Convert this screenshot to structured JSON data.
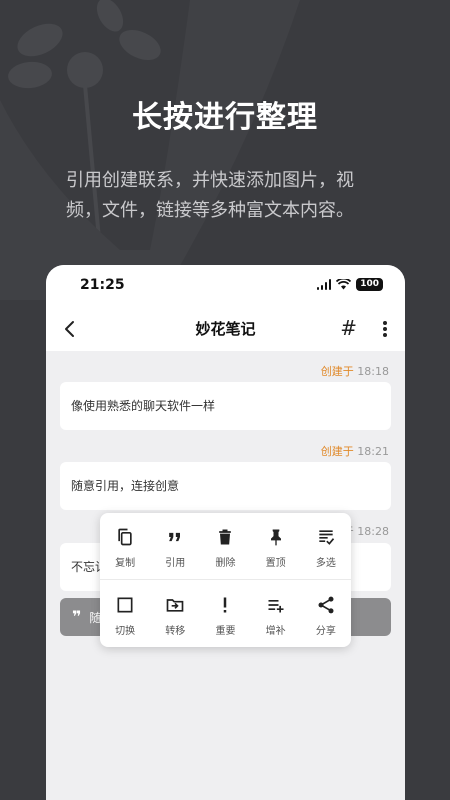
{
  "headline": "长按进行整理",
  "subtitle": "引用创建联系，并快速添加图片，视频，文件，链接等多种富文本内容。",
  "status_bar": {
    "time": "21:25",
    "battery": "100"
  },
  "app_bar": {
    "title": "妙花笔记",
    "tag_icon": "#"
  },
  "notes": [
    {
      "created_label": "创建于",
      "time": "18:18",
      "text": "像使用熟悉的聊天软件一样"
    },
    {
      "created_label": "创建于",
      "time": "18:21",
      "text": "随意引用，连接创意"
    },
    {
      "created_label": "",
      "time": "于 18:28",
      "text": "不忘记"
    }
  ],
  "quote": {
    "mark": "❞",
    "text": "随"
  },
  "menu": {
    "row1": [
      {
        "icon": "copy-icon",
        "label": "复制"
      },
      {
        "icon": "quote-icon",
        "label": "引用"
      },
      {
        "icon": "trash-icon",
        "label": "删除"
      },
      {
        "icon": "pin-icon",
        "label": "置顶"
      },
      {
        "icon": "multiselect-icon",
        "label": "多选"
      }
    ],
    "row2": [
      {
        "icon": "toggle-square-icon",
        "label": "切换"
      },
      {
        "icon": "move-folder-icon",
        "label": "转移"
      },
      {
        "icon": "important-icon",
        "label": "重要"
      },
      {
        "icon": "add-list-icon",
        "label": "增补"
      },
      {
        "icon": "share-icon",
        "label": "分享"
      }
    ]
  },
  "colors": {
    "background": "#3a3b3f",
    "accent": "#e08a2b",
    "quote_bar": "#8c8c8e"
  }
}
